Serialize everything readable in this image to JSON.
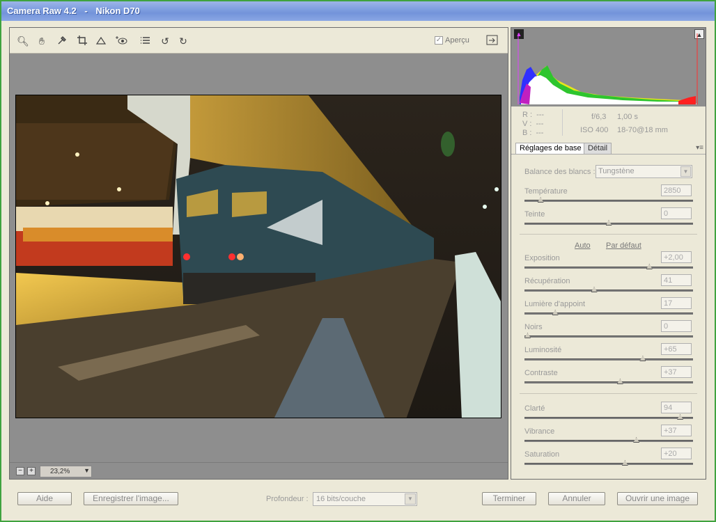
{
  "window": {
    "app": "Camera Raw 4.2",
    "separator": "-",
    "camera": "Nikon D70"
  },
  "toolbar": {
    "tools": [
      "zoom-icon",
      "hand-icon",
      "white-balance-icon",
      "crop-icon",
      "straighten-icon",
      "red-eye-icon",
      "preferences-icon",
      "rotate-left-icon",
      "rotate-right-icon"
    ],
    "preview_label": "Aperçu",
    "preview_checked": true
  },
  "zoom": {
    "minus": "−",
    "plus": "+",
    "value": "23,2%",
    "arrow": "▼"
  },
  "histogram": {
    "shadow_clip_icon": "▲",
    "highlight_clip_icon": "▲"
  },
  "readout": {
    "r_label": "R :",
    "r_value": "---",
    "v_label": "V :",
    "v_value": "---",
    "b_label": "B :",
    "b_value": "---",
    "aperture": "f/6,3",
    "shutter": "1,00 s",
    "iso": "ISO 400",
    "lens": "18-70@18 mm"
  },
  "tabs": {
    "basic": "Réglages de base",
    "detail": "Détail",
    "menu_icon": "▾≡"
  },
  "basic": {
    "wb_label": "Balance des blancs :",
    "wb_value": "Tungstène",
    "wb_arrow": "▼",
    "temperature_label": "Température",
    "temperature_value": "2850",
    "temperature_pos": 0.08,
    "tint_label": "Teinte",
    "tint_value": "0",
    "tint_pos": 0.5,
    "auto_link": "Auto",
    "default_link": "Par défaut",
    "exposure_label": "Exposition",
    "exposure_value": "+2,00",
    "exposure_pos": 0.75,
    "recovery_label": "Récupération",
    "recovery_value": "41",
    "recovery_pos": 0.41,
    "fill_label": "Lumière d'appoint",
    "fill_value": "17",
    "fill_pos": 0.17,
    "blacks_label": "Noirs",
    "blacks_value": "0",
    "blacks_pos": 0.0,
    "brightness_label": "Luminosité",
    "brightness_value": "+65",
    "brightness_pos": 0.71,
    "contrast_label": "Contraste",
    "contrast_value": "+37",
    "contrast_pos": 0.57,
    "clarity_label": "Clarté",
    "clarity_value": "94",
    "clarity_pos": 0.94,
    "vibrance_label": "Vibrance",
    "vibrance_value": "+37",
    "vibrance_pos": 0.67,
    "saturation_label": "Saturation",
    "saturation_value": "+20",
    "saturation_pos": 0.6
  },
  "footer": {
    "help": "Aide",
    "save": "Enregistrer l'image...",
    "depth_label": "Profondeur :",
    "depth_value": "16 bits/couche",
    "depth_arrow": "▼",
    "done": "Terminer",
    "cancel": "Annuler",
    "open": "Ouvrir une image"
  }
}
